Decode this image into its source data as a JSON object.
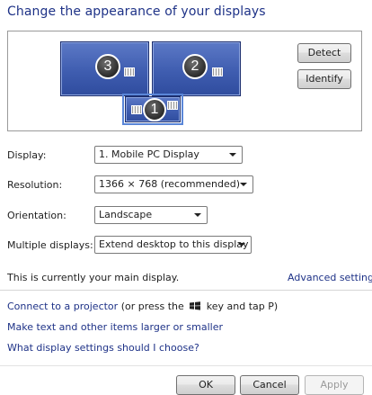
{
  "header": {
    "title": "Change the appearance of your displays"
  },
  "preview": {
    "monitors": [
      {
        "number": "3"
      },
      {
        "number": "2"
      },
      {
        "number": "1"
      }
    ],
    "detect_label": "Detect",
    "identify_label": "Identify"
  },
  "settings": {
    "display": {
      "label": "Display:",
      "value": "1. Mobile PC Display"
    },
    "resolution": {
      "label": "Resolution:",
      "value": "1366 × 768 (recommended)"
    },
    "orientation": {
      "label": "Orientation:",
      "value": "Landscape"
    },
    "multiple": {
      "label": "Multiple displays:",
      "value": "Extend desktop to this display"
    }
  },
  "status": {
    "main_display_text": "This is currently your main display.",
    "advanced_link": "Advanced settings"
  },
  "links": {
    "projector_link": "Connect to a projector",
    "projector_rest_before": "(or press the",
    "projector_rest_after": "key and tap P)",
    "text_size_link": "Make text and other items larger or smaller",
    "which_settings_link": "What display settings should I choose?"
  },
  "footer": {
    "ok_label": "OK",
    "cancel_label": "Cancel",
    "apply_label": "Apply"
  },
  "colors": {
    "link": "#1e3287",
    "monitor": "#4a67ba"
  }
}
